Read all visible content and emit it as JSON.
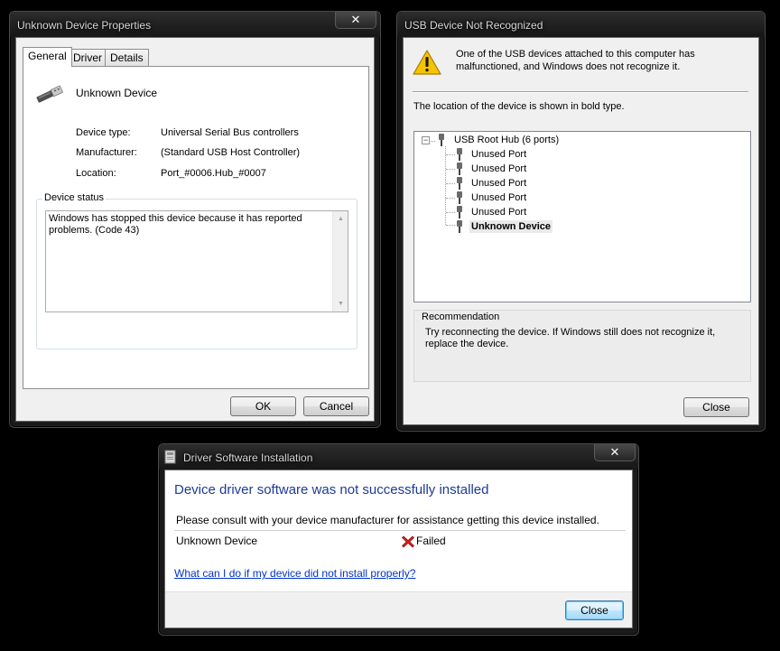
{
  "properties_window": {
    "title": "Unknown Device Properties",
    "tabs": [
      "General",
      "Driver",
      "Details"
    ],
    "device_name": "Unknown Device",
    "device_type_label": "Device type:",
    "device_type_value": "Universal Serial Bus controllers",
    "manufacturer_label": "Manufacturer:",
    "manufacturer_value": "(Standard USB Host Controller)",
    "location_label": "Location:",
    "location_value": "Port_#0006.Hub_#0007",
    "status_group_label": "Device status",
    "status_text": "Windows has stopped this device because it has reported problems. (Code 43)",
    "ok_label": "OK",
    "cancel_label": "Cancel",
    "close_glyph": "✕"
  },
  "usb_window": {
    "title": "USB Device Not Recognized",
    "message": "One of the USB devices attached to this computer has malfunctioned, and Windows does not recognize it.",
    "location_hint": "The location of the device is shown in bold type.",
    "tree": {
      "root": "USB Root Hub (6 ports)",
      "expander_glyph": "−",
      "children": [
        {
          "label": "Unused Port",
          "bold": false
        },
        {
          "label": "Unused Port",
          "bold": false
        },
        {
          "label": "Unused Port",
          "bold": false
        },
        {
          "label": "Unused Port",
          "bold": false
        },
        {
          "label": "Unused Port",
          "bold": false
        },
        {
          "label": "Unknown Device",
          "bold": true
        }
      ]
    },
    "recommendation_label": "Recommendation",
    "recommendation_text": "Try reconnecting the device. If Windows still does not recognize it, replace the device.",
    "close_label": "Close",
    "close_glyph": "✕"
  },
  "driver_window": {
    "title": "Driver Software Installation",
    "heading": "Device driver software was not successfully installed",
    "consult_text": "Please consult with your device manufacturer for assistance getting this device installed.",
    "device_name": "Unknown Device",
    "status": "Failed",
    "help_link": "What can I do if my device did not install properly?",
    "close_label": "Close",
    "close_glyph": "✕"
  },
  "colors": {
    "heading_blue": "#1e3a96",
    "link_blue": "#0033cc",
    "failed_red": "#d81e1e",
    "warning_yellow": "#f5c400"
  }
}
